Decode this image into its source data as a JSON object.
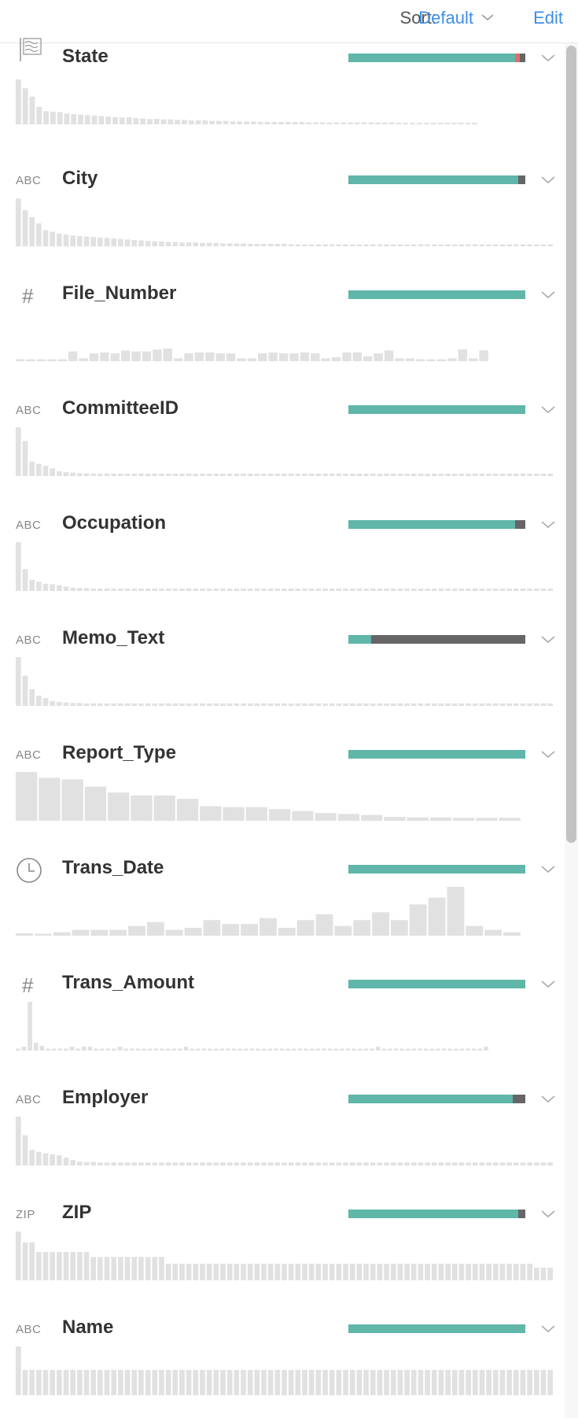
{
  "toolbar": {
    "sort_label": "Sort:",
    "sort_value": "Default",
    "edit_label": "Edit"
  },
  "colors": {
    "valid": "#5fb6a9",
    "mismatched": "#e06c6c",
    "missing": "#666666",
    "histogram": "#e1e1e1",
    "link": "#3d8ee6"
  },
  "columns": [
    {
      "name": "State",
      "type": "geo",
      "icon": "flag-icon",
      "quality": {
        "valid": 0.94,
        "mismatched": 0.03,
        "missing": 0.03
      },
      "histogram": [
        0.92,
        0.74,
        0.57,
        0.36,
        0.27,
        0.26,
        0.25,
        0.22,
        0.21,
        0.2,
        0.19,
        0.18,
        0.17,
        0.16,
        0.15,
        0.14,
        0.14,
        0.13,
        0.12,
        0.11,
        0.11,
        0.1,
        0.1,
        0.09,
        0.09,
        0.08,
        0.08,
        0.08,
        0.07,
        0.07,
        0.07,
        0.06,
        0.06,
        0.06,
        0.06,
        0.05,
        0.05,
        0.05,
        0.05,
        0.05,
        0.05,
        0.05,
        0.04,
        0.04,
        0.04,
        0.04,
        0.04,
        0.04,
        0.04,
        0.04,
        0.04,
        0.04,
        0.04,
        0.04,
        0.04,
        0.03,
        0.03,
        0.03,
        0.03,
        0.03,
        0.03,
        0.03,
        0.03,
        0.03,
        0.03,
        0.03,
        0.03
      ],
      "hist_width": 0.86
    },
    {
      "name": "City",
      "type": "string",
      "icon": "abc-icon",
      "quality": {
        "valid": 0.96,
        "mismatched": 0,
        "missing": 0.04
      },
      "histogram": [
        0.98,
        0.74,
        0.6,
        0.47,
        0.33,
        0.3,
        0.26,
        0.24,
        0.22,
        0.21,
        0.2,
        0.19,
        0.18,
        0.17,
        0.16,
        0.15,
        0.14,
        0.13,
        0.12,
        0.11,
        0.1,
        0.1,
        0.09,
        0.09,
        0.08,
        0.08,
        0.08,
        0.07,
        0.07,
        0.07,
        0.06,
        0.06,
        0.06,
        0.06,
        0.05,
        0.05,
        0.05,
        0.05,
        0.05,
        0.05,
        0.04,
        0.04,
        0.04,
        0.04,
        0.04,
        0.04,
        0.04,
        0.04,
        0.04,
        0.04,
        0.04,
        0.04,
        0.04,
        0.04,
        0.04,
        0.04,
        0.04,
        0.04,
        0.04,
        0.04,
        0.04,
        0.04,
        0.04,
        0.04,
        0.04,
        0.04,
        0.04,
        0.04,
        0.04,
        0.04,
        0.04,
        0.04,
        0.04,
        0.04,
        0.04,
        0.04,
        0.04,
        0.04,
        0.04
      ],
      "hist_width": 1.0
    },
    {
      "name": "File_Number",
      "type": "number",
      "icon": "hash-icon",
      "quality": {
        "valid": 1.0,
        "mismatched": 0,
        "missing": 0
      },
      "histogram": [
        0.04,
        0.04,
        0.04,
        0.04,
        0.04,
        0.2,
        0.06,
        0.16,
        0.18,
        0.16,
        0.22,
        0.2,
        0.2,
        0.24,
        0.26,
        0.06,
        0.16,
        0.18,
        0.18,
        0.16,
        0.16,
        0.06,
        0.06,
        0.16,
        0.18,
        0.16,
        0.16,
        0.18,
        0.16,
        0.06,
        0.08,
        0.18,
        0.18,
        0.1,
        0.16,
        0.22,
        0.06,
        0.06,
        0.04,
        0.04,
        0.04,
        0.06,
        0.24,
        0.06,
        0.22
      ],
      "hist_width": 0.88
    },
    {
      "name": "CommitteeID",
      "type": "string",
      "icon": "abc-icon",
      "quality": {
        "valid": 1.0,
        "mismatched": 0,
        "missing": 0
      },
      "histogram": [
        1.0,
        0.72,
        0.3,
        0.25,
        0.21,
        0.16,
        0.1,
        0.08,
        0.07,
        0.06,
        0.06,
        0.05,
        0.05,
        0.05,
        0.05,
        0.05,
        0.05,
        0.05,
        0.05,
        0.05,
        0.05,
        0.05,
        0.05,
        0.05,
        0.05,
        0.05,
        0.05,
        0.05,
        0.05,
        0.05,
        0.05,
        0.05,
        0.05,
        0.05,
        0.05,
        0.05,
        0.05,
        0.05,
        0.05,
        0.05,
        0.05,
        0.05,
        0.05,
        0.05,
        0.05,
        0.05,
        0.05,
        0.05,
        0.05,
        0.05,
        0.05,
        0.05,
        0.05,
        0.05,
        0.05,
        0.05,
        0.05,
        0.05,
        0.05,
        0.05,
        0.05,
        0.05,
        0.05,
        0.05,
        0.05,
        0.05,
        0.05,
        0.05,
        0.05,
        0.05,
        0.05,
        0.05,
        0.05,
        0.05,
        0.05,
        0.05,
        0.05,
        0.05,
        0.05
      ],
      "hist_width": 1.0
    },
    {
      "name": "Occupation",
      "type": "string",
      "icon": "abc-icon",
      "quality": {
        "valid": 0.94,
        "mismatched": 0,
        "missing": 0.06
      },
      "histogram": [
        1.0,
        0.45,
        0.23,
        0.19,
        0.15,
        0.14,
        0.12,
        0.09,
        0.07,
        0.06,
        0.06,
        0.05,
        0.05,
        0.05,
        0.05,
        0.05,
        0.05,
        0.05,
        0.05,
        0.05,
        0.05,
        0.05,
        0.05,
        0.05,
        0.05,
        0.05,
        0.05,
        0.05,
        0.05,
        0.05,
        0.05,
        0.05,
        0.05,
        0.05,
        0.05,
        0.05,
        0.05,
        0.05,
        0.05,
        0.05,
        0.05,
        0.05,
        0.05,
        0.05,
        0.05,
        0.05,
        0.05,
        0.05,
        0.05,
        0.05,
        0.05,
        0.05,
        0.05,
        0.05,
        0.05,
        0.05,
        0.05,
        0.05,
        0.05,
        0.05,
        0.05,
        0.05,
        0.05,
        0.05,
        0.05,
        0.05,
        0.05,
        0.05,
        0.05,
        0.05,
        0.05,
        0.05,
        0.05,
        0.05,
        0.05,
        0.05,
        0.05,
        0.05,
        0.05
      ],
      "hist_width": 1.0
    },
    {
      "name": "Memo_Text",
      "type": "string",
      "icon": "abc-icon",
      "quality": {
        "valid": 0.13,
        "mismatched": 0,
        "missing": 0.87
      },
      "histogram": [
        1.0,
        0.62,
        0.34,
        0.21,
        0.16,
        0.1,
        0.08,
        0.07,
        0.06,
        0.06,
        0.05,
        0.05,
        0.05,
        0.05,
        0.05,
        0.05,
        0.05,
        0.05,
        0.05,
        0.05,
        0.05,
        0.05,
        0.05,
        0.05,
        0.05,
        0.05,
        0.05,
        0.05,
        0.05,
        0.05,
        0.05,
        0.05,
        0.05,
        0.05,
        0.05,
        0.05,
        0.05,
        0.05,
        0.05,
        0.05,
        0.05,
        0.05,
        0.05,
        0.05,
        0.05,
        0.05,
        0.05,
        0.05,
        0.05,
        0.05,
        0.05,
        0.05,
        0.05,
        0.05,
        0.05,
        0.05,
        0.05,
        0.05,
        0.05,
        0.05,
        0.05,
        0.05,
        0.05,
        0.05,
        0.05,
        0.05,
        0.05,
        0.05,
        0.05,
        0.05,
        0.05,
        0.05,
        0.05,
        0.05,
        0.05,
        0.05,
        0.05,
        0.05,
        0.05
      ],
      "hist_width": 1.0
    },
    {
      "name": "Report_Type",
      "type": "string",
      "icon": "abc-icon",
      "quality": {
        "valid": 1.0,
        "mismatched": 0,
        "missing": 0
      },
      "histogram": [
        1.0,
        0.88,
        0.85,
        0.7,
        0.58,
        0.52,
        0.52,
        0.45,
        0.3,
        0.28,
        0.28,
        0.24,
        0.2,
        0.16,
        0.14,
        0.12,
        0.08,
        0.07,
        0.07,
        0.06,
        0.06,
        0.06
      ],
      "hist_width": 0.94
    },
    {
      "name": "Trans_Date",
      "type": "date",
      "icon": "clock-icon",
      "quality": {
        "valid": 1.0,
        "mismatched": 0,
        "missing": 0
      },
      "histogram": [
        0.05,
        0.04,
        0.07,
        0.12,
        0.12,
        0.12,
        0.2,
        0.28,
        0.12,
        0.16,
        0.32,
        0.24,
        0.24,
        0.36,
        0.16,
        0.32,
        0.44,
        0.2,
        0.32,
        0.48,
        0.32,
        0.64,
        0.78,
        1.0,
        0.2,
        0.12,
        0.07
      ],
      "hist_width": 0.94
    },
    {
      "name": "Trans_Amount",
      "type": "number",
      "icon": "hash-icon",
      "quality": {
        "valid": 1.0,
        "mismatched": 0,
        "missing": 0
      },
      "histogram": [
        0.04,
        0.08,
        1.0,
        0.16,
        0.1,
        0.04,
        0.04,
        0.04,
        0.04,
        0.08,
        0.04,
        0.08,
        0.08,
        0.04,
        0.04,
        0.04,
        0.04,
        0.08,
        0.04,
        0.04,
        0.04,
        0.04,
        0.04,
        0.04,
        0.04,
        0.04,
        0.04,
        0.04,
        0.08,
        0.04,
        0.04,
        0.04,
        0.04,
        0.04,
        0.04,
        0.04,
        0.04,
        0.04,
        0.04,
        0.04,
        0.04,
        0.04,
        0.04,
        0.04,
        0.04,
        0.04,
        0.04,
        0.04,
        0.04,
        0.04,
        0.04,
        0.04,
        0.04,
        0.04,
        0.04,
        0.04,
        0.04,
        0.04,
        0.04,
        0.04,
        0.08,
        0.04,
        0.04,
        0.04,
        0.04,
        0.04,
        0.04,
        0.04,
        0.04,
        0.04,
        0.04,
        0.04,
        0.04,
        0.04,
        0.04,
        0.04,
        0.04,
        0.04,
        0.08
      ],
      "hist_width": 0.88
    },
    {
      "name": "Employer",
      "type": "string",
      "icon": "abc-icon",
      "quality": {
        "valid": 0.93,
        "mismatched": 0,
        "missing": 0.07
      },
      "histogram": [
        1.0,
        0.62,
        0.32,
        0.28,
        0.25,
        0.23,
        0.21,
        0.16,
        0.11,
        0.08,
        0.07,
        0.07,
        0.06,
        0.06,
        0.06,
        0.06,
        0.06,
        0.06,
        0.06,
        0.06,
        0.06,
        0.06,
        0.06,
        0.06,
        0.06,
        0.06,
        0.06,
        0.06,
        0.06,
        0.06,
        0.06,
        0.06,
        0.06,
        0.06,
        0.06,
        0.06,
        0.06,
        0.06,
        0.06,
        0.06,
        0.06,
        0.06,
        0.06,
        0.06,
        0.06,
        0.06,
        0.06,
        0.06,
        0.06,
        0.06,
        0.06,
        0.06,
        0.06,
        0.06,
        0.06,
        0.06,
        0.06,
        0.06,
        0.06,
        0.06,
        0.06,
        0.06,
        0.06,
        0.06,
        0.06,
        0.06,
        0.06,
        0.06,
        0.06,
        0.06,
        0.06,
        0.06,
        0.06,
        0.06,
        0.06,
        0.06,
        0.06,
        0.06,
        0.06
      ],
      "hist_width": 1.0
    },
    {
      "name": "ZIP",
      "type": "zip",
      "icon": "zip-icon",
      "quality": {
        "valid": 0.96,
        "mismatched": 0,
        "missing": 0.04
      },
      "histogram": [
        1.0,
        0.78,
        0.78,
        0.58,
        0.58,
        0.58,
        0.58,
        0.58,
        0.58,
        0.58,
        0.58,
        0.48,
        0.48,
        0.48,
        0.48,
        0.48,
        0.48,
        0.48,
        0.48,
        0.48,
        0.48,
        0.48,
        0.34,
        0.34,
        0.34,
        0.34,
        0.34,
        0.34,
        0.34,
        0.34,
        0.34,
        0.34,
        0.34,
        0.34,
        0.34,
        0.34,
        0.34,
        0.34,
        0.34,
        0.34,
        0.34,
        0.34,
        0.34,
        0.34,
        0.34,
        0.34,
        0.34,
        0.34,
        0.34,
        0.34,
        0.34,
        0.34,
        0.34,
        0.34,
        0.34,
        0.34,
        0.34,
        0.34,
        0.34,
        0.34,
        0.34,
        0.34,
        0.34,
        0.34,
        0.34,
        0.34,
        0.34,
        0.34,
        0.34,
        0.34,
        0.34,
        0.34,
        0.34,
        0.34,
        0.34,
        0.34,
        0.26,
        0.26,
        0.26
      ],
      "hist_width": 1.0
    },
    {
      "name": "Name",
      "type": "string",
      "icon": "abc-icon",
      "quality": {
        "valid": 1.0,
        "mismatched": 0,
        "missing": 0
      },
      "histogram": [
        1.0,
        0.52,
        0.52,
        0.52,
        0.52,
        0.52,
        0.52,
        0.52,
        0.52,
        0.52,
        0.52,
        0.52,
        0.52,
        0.52,
        0.52,
        0.52,
        0.52,
        0.52,
        0.52,
        0.52,
        0.52,
        0.52,
        0.52,
        0.52,
        0.52,
        0.52,
        0.52,
        0.52,
        0.52,
        0.52,
        0.52,
        0.52,
        0.52,
        0.52,
        0.52,
        0.52,
        0.52,
        0.52,
        0.52,
        0.52,
        0.52,
        0.52,
        0.52,
        0.52,
        0.52,
        0.52,
        0.52,
        0.52,
        0.52,
        0.52,
        0.52,
        0.52,
        0.52,
        0.52,
        0.52,
        0.52,
        0.52,
        0.52,
        0.52,
        0.52,
        0.52,
        0.52,
        0.52,
        0.52,
        0.52,
        0.52,
        0.52,
        0.52,
        0.52,
        0.52,
        0.52,
        0.52,
        0.52,
        0.52,
        0.52,
        0.52,
        0.52,
        0.52,
        0.52
      ],
      "hist_width": 1.0
    }
  ],
  "icon_text": {
    "abc": "ABC",
    "zip": "ZIP",
    "hash": "#"
  },
  "scrollbar": {
    "visible_fraction": 0.58
  }
}
